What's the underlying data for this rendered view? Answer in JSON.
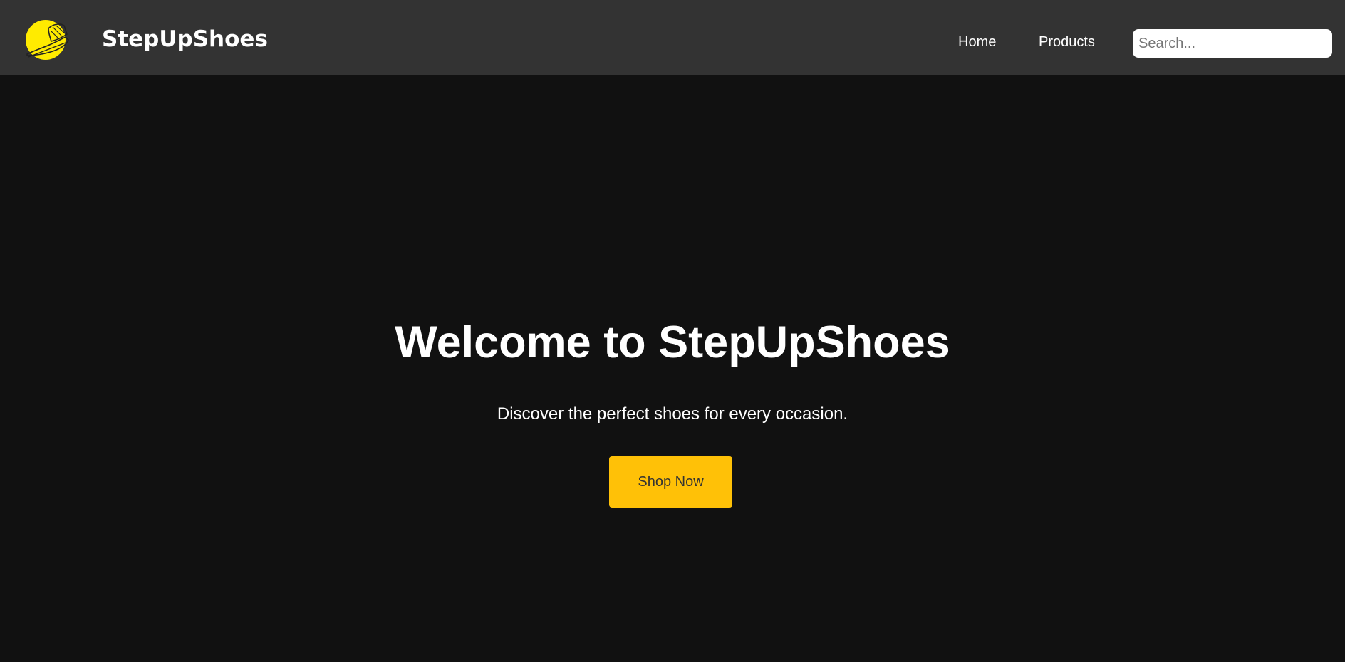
{
  "header": {
    "brand": "StepUpShoes",
    "logo_icon": "sneaker-icon",
    "nav": [
      {
        "label": "Home"
      },
      {
        "label": "Products"
      }
    ],
    "search": {
      "placeholder": "Search...",
      "value": ""
    }
  },
  "hero": {
    "title": "Welcome to StepUpShoes",
    "subtitle": "Discover the perfect shoes for every occasion.",
    "cta_label": "Shop Now"
  },
  "colors": {
    "header_bg": "#333333",
    "page_bg": "#111111",
    "accent": "#ffc107",
    "logo_yellow": "#ffeb00"
  }
}
